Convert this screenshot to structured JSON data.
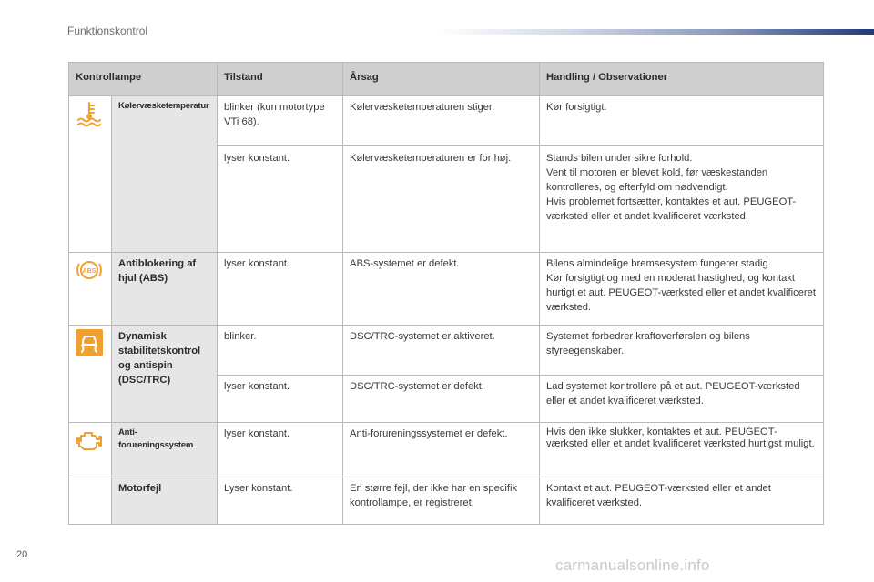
{
  "header": {
    "section_title": "Funktionskontrol"
  },
  "table": {
    "columns": [
      "Kontrollampe",
      "Tilstand",
      "Årsag",
      "Handling / Observationer"
    ],
    "lamps": [
      {
        "name": "Kølervæsketemperatur",
        "icon": "coolant-temperature-icon",
        "rows": [
          {
            "state": "blinker (kun motortype VTi 68).",
            "cause": "Kølervæsketemperaturen stiger.",
            "action": "Kør forsigtigt."
          },
          {
            "state": "lyser konstant.",
            "cause": "Kølervæsketemperaturen er for høj.",
            "action": "Stands bilen under sikre forhold.\nVent til motoren er blevet kold, før væskestanden kontrolleres, og efterfyld om nødvendigt.\nHvis problemet fortsætter, kontaktes et aut. PEUGEOT-værksted eller et andet kvalificeret værksted."
          }
        ]
      },
      {
        "name": "Antiblokering af hjul (ABS)",
        "icon": "abs-icon",
        "rows": [
          {
            "state": "lyser konstant.",
            "cause": "ABS-systemet er defekt.",
            "action": "Bilens almindelige bremsesystem fungerer stadig.\nKør forsigtigt og med en moderat hastighed, og kontakt hurtigt et aut. PEUGEOT-værksted eller et andet kvalificeret værksted."
          }
        ]
      },
      {
        "name": "Dynamisk stabilitetskontrol og antispin (DSC/TRC)",
        "icon": "stability-control-icon",
        "rows": [
          {
            "state": "blinker.",
            "cause": "DSC/TRC-systemet er aktiveret.",
            "action": "Systemet forbedrer kraftoverførslen og bilens styreegenskaber."
          },
          {
            "state": "lyser konstant.",
            "cause": "DSC/TRC-systemet er defekt.",
            "action": "Lad systemet kontrollere på et aut. PEUGEOT-værksted eller et andet kvalificeret værksted."
          }
        ]
      },
      {
        "name": "Anti-forureningssystem",
        "icon": "engine-check-icon",
        "rows": [
          {
            "state": "lyser konstant.",
            "cause": "Anti-forureningssystemet er defekt.",
            "action": "Hvis den ikke slukker, kontaktes et aut. PEUGEOT-værksted eller et andet kvalificeret værksted hurtigst muligt."
          }
        ]
      },
      {
        "name": "Motorfejl",
        "icon": "",
        "rows": [
          {
            "state": "Lyser konstant.",
            "cause": "En større fejl, der ikke har en specifik kontrollampe, er registreret.",
            "action": "Kontakt et aut. PEUGEOT-værksted eller et andet kvalificeret værksted."
          }
        ]
      }
    ]
  },
  "footer": {
    "page_number": "20",
    "watermark": "carmanualsonline.info"
  },
  "colors": {
    "icon_orange": "#f0a030",
    "header_gray": "#cfcfcf",
    "name_gray": "#e6e6e6",
    "brand_blue": "#1f3a7a"
  }
}
